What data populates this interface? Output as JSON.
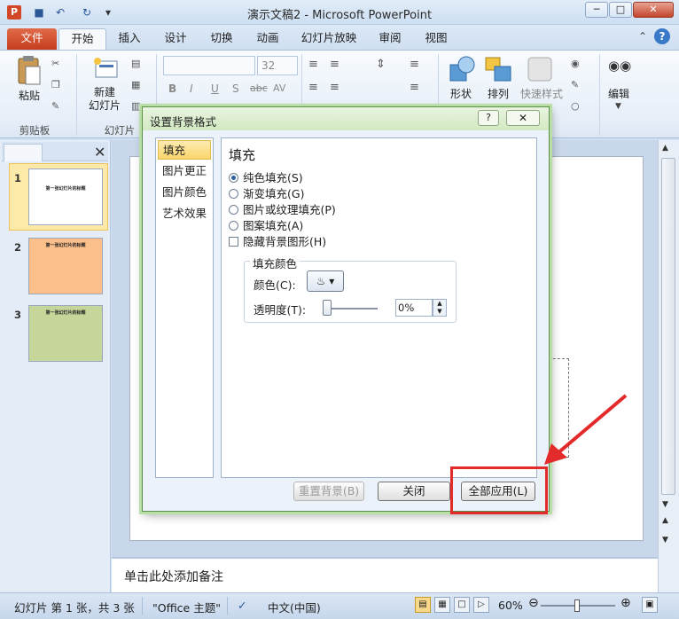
{
  "window": {
    "app_icon": "P",
    "title": "演示文稿2 - Microsoft PowerPoint"
  },
  "tabs": [
    "文件",
    "开始",
    "插入",
    "设计",
    "切换",
    "动画",
    "幻灯片放映",
    "审阅",
    "视图"
  ],
  "ribbon": {
    "paste_label": "粘贴",
    "new_slide_label": "新建\n幻灯片",
    "font_size": "32",
    "shapes_label": "形状",
    "arrange_label": "排列",
    "quick_styles_label": "快速样式",
    "edit_label": "编辑",
    "group_clipboard": "剪贴板",
    "group_slides": "幻灯片",
    "format_buttons": [
      "B",
      "I",
      "U",
      "S",
      "abc",
      "AV"
    ]
  },
  "slides_panel": {
    "thumbnails": [
      {
        "number": "1",
        "text": "第一张幻灯片的标题",
        "color": "#ffffff"
      },
      {
        "number": "2",
        "text": "第一张幻灯片的标题",
        "color": "#fbbf8c"
      },
      {
        "number": "3",
        "text": "第一张幻灯片的标题",
        "color": "#c6d59a"
      }
    ]
  },
  "notes": {
    "placeholder": "单击此处添加备注"
  },
  "statusbar": {
    "slide_info": "幻灯片 第 1 张，共 3 张",
    "theme": "\"Office 主题\"",
    "language": "中文(中国)",
    "zoom": "60%"
  },
  "dialog": {
    "title": "设置背景格式",
    "help": "?",
    "close": "✕",
    "nav_items": [
      "填充",
      "图片更正",
      "图片颜色",
      "艺术效果"
    ],
    "content_title": "填充",
    "options": {
      "solid_fill": "纯色填充(S)",
      "gradient_fill": "渐变填充(G)",
      "picture_fill": "图片或纹理填充(P)",
      "pattern_fill": "图案填充(A)",
      "hide_bg_graphics": "隐藏背景图形(H)"
    },
    "fill_color_group": "填充颜色",
    "color_label": "颜色(C):",
    "transparency_label": "透明度(T):",
    "transparency_value": "0%",
    "buttons": {
      "reset": "重置背景(B)",
      "close": "关闭",
      "apply_all": "全部应用(L)"
    }
  },
  "colors": {
    "file_tab": "#d24726",
    "highlight": "#e32b2b",
    "dialog_border": "#5c8d4a"
  }
}
